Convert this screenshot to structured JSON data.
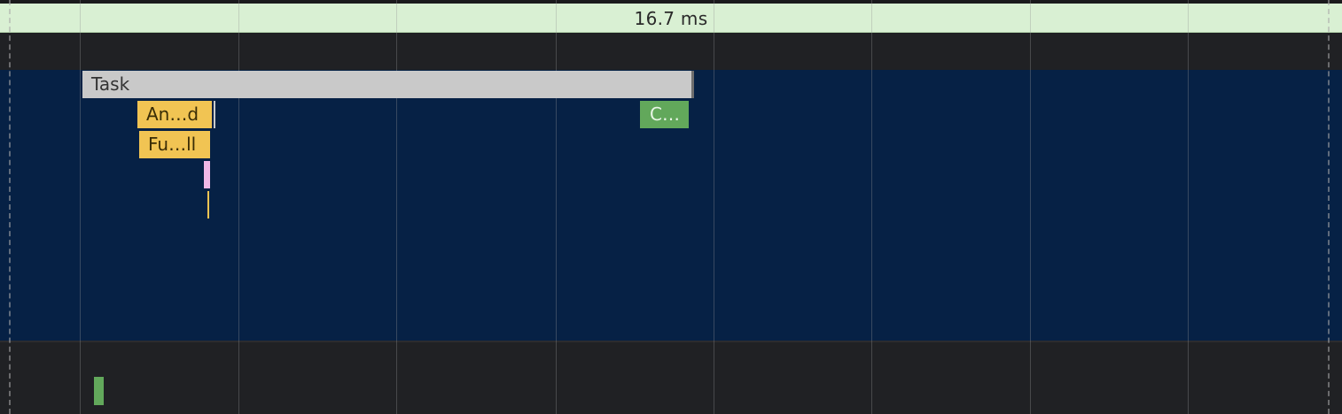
{
  "frame": {
    "duration_label": "16.7 ms"
  },
  "events": {
    "task": {
      "label": "Task"
    },
    "animation_frame": {
      "label": "An…d"
    },
    "function_call": {
      "label": "Fu…ll"
    },
    "composite": {
      "label": "C…"
    }
  },
  "colors": {
    "frame_bar": "#d9f0d3",
    "main_track": "#062145",
    "task": "#c9c9c9",
    "script": "#f1c453",
    "composite": "#62a85b",
    "paint_marker": "#f0b8e6",
    "bottom_marker": "#62a85b"
  }
}
